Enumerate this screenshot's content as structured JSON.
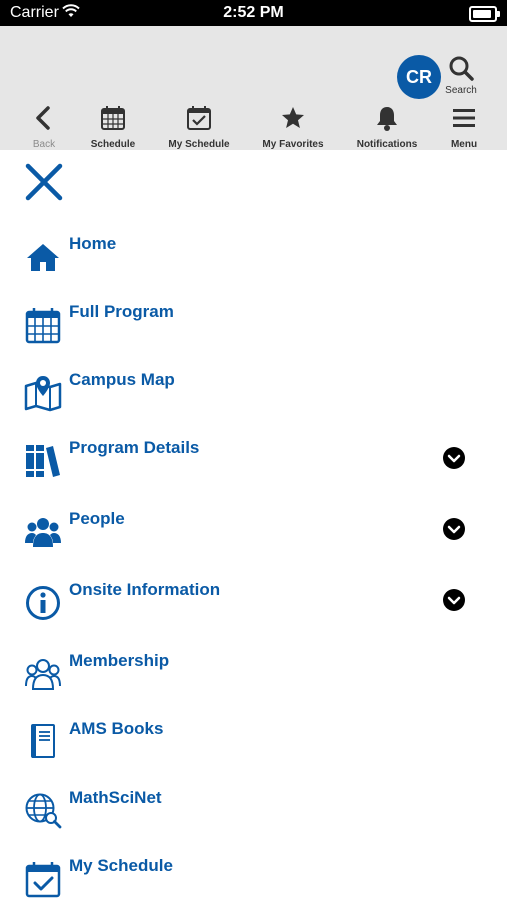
{
  "status_bar": {
    "carrier": "Carrier",
    "time": "2:52 PM"
  },
  "header": {
    "avatar_initials": "CR",
    "search_label": "Search",
    "toolbar": [
      {
        "label": "Back",
        "icon": "chevron-left-icon"
      },
      {
        "label": "Schedule",
        "icon": "calendar-icon"
      },
      {
        "label": "My Schedule",
        "icon": "calendar-check-icon"
      },
      {
        "label": "My Favorites",
        "icon": "star-icon"
      },
      {
        "label": "Notifications",
        "icon": "bell-icon"
      },
      {
        "label": "Menu",
        "icon": "hamburger-icon"
      }
    ]
  },
  "menu": {
    "items": [
      {
        "label": "Home",
        "icon": "home-icon",
        "expandable": false
      },
      {
        "label": "Full Program",
        "icon": "calendar-icon",
        "expandable": false
      },
      {
        "label": "Campus Map",
        "icon": "map-icon",
        "expandable": false
      },
      {
        "label": "Program Details",
        "icon": "books-icon",
        "expandable": true
      },
      {
        "label": "People",
        "icon": "people-icon",
        "expandable": true
      },
      {
        "label": "Onsite Information",
        "icon": "info-icon",
        "expandable": true
      },
      {
        "label": "Membership",
        "icon": "membership-icon",
        "expandable": false
      },
      {
        "label": "AMS Books",
        "icon": "book-icon",
        "expandable": false
      },
      {
        "label": "MathSciNet",
        "icon": "globe-search-icon",
        "expandable": false
      },
      {
        "label": "My Schedule",
        "icon": "calendar-check-icon",
        "expandable": false
      }
    ]
  },
  "colors": {
    "accent": "#0a5aa6",
    "header_bg": "#e6e6e6",
    "status_bar_bg": "#000000"
  }
}
